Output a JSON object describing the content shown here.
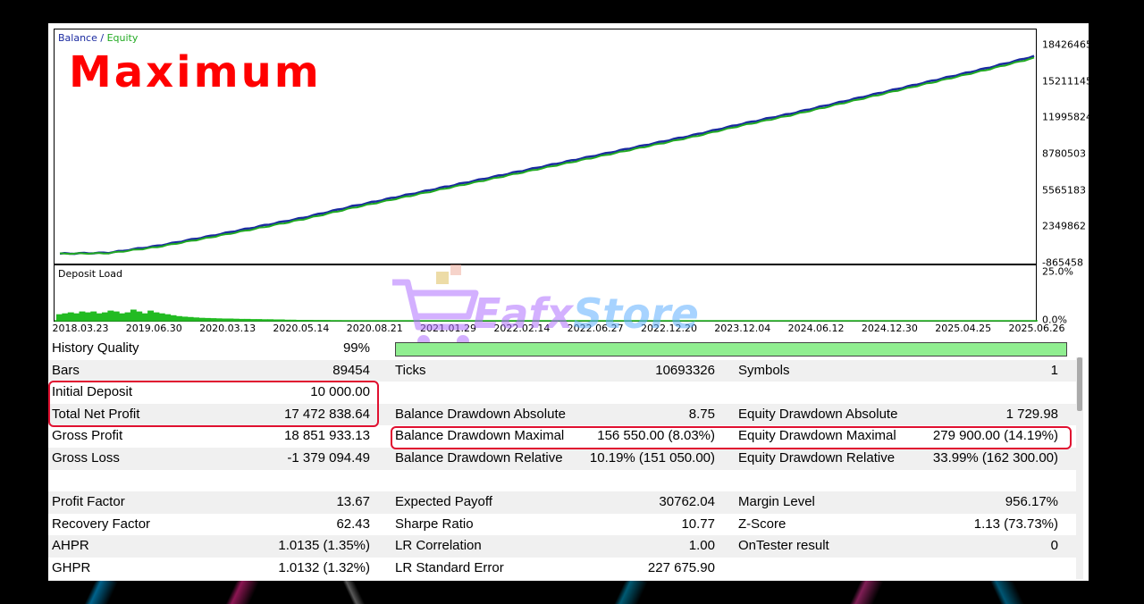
{
  "chart_data": [
    {
      "type": "line",
      "legend": {
        "balance": "Balance",
        "sep": " / ",
        "equity": "Equity"
      },
      "yticks": [
        "18426465",
        "15211145",
        "11995824",
        "8780503",
        "5565183",
        "2349862",
        "-865458"
      ],
      "ytick_values": [
        18426465,
        15211145,
        11995824,
        8780503,
        5565183,
        2349862,
        -865458
      ],
      "ylim": [
        -865458,
        18426465
      ],
      "series": [
        {
          "name": "Balance",
          "color": "#1a2aa0",
          "x": [
            0,
            0.05,
            0.1,
            0.15,
            0.2,
            0.25,
            0.3,
            0.35,
            0.4,
            0.45,
            0.5,
            0.55,
            0.6,
            0.65,
            0.7,
            0.75,
            0.8,
            0.85,
            0.9,
            0.95,
            1.0
          ],
          "values": [
            10000,
            90000,
            700000,
            1500000,
            2350000,
            3200000,
            4200000,
            5100000,
            6000000,
            6900000,
            7800000,
            8700000,
            9600000,
            10500000,
            11500000,
            12400000,
            13400000,
            14400000,
            15400000,
            16400000,
            17482838
          ]
        },
        {
          "name": "Equity",
          "color": "#22aa22",
          "x": [
            0,
            0.05,
            0.1,
            0.15,
            0.2,
            0.25,
            0.3,
            0.35,
            0.4,
            0.45,
            0.5,
            0.55,
            0.6,
            0.65,
            0.7,
            0.75,
            0.8,
            0.85,
            0.9,
            0.95,
            1.0
          ],
          "values": [
            10000,
            50000,
            600000,
            1380000,
            2200000,
            3050000,
            4050000,
            4950000,
            5850000,
            6750000,
            7650000,
            8550000,
            9450000,
            10350000,
            11350000,
            12250000,
            13250000,
            14250000,
            15250000,
            16250000,
            17330000
          ]
        }
      ]
    },
    {
      "type": "bar",
      "title": "Deposit Load",
      "yticks": [
        "25.0%",
        "0.0%"
      ],
      "ylim": [
        0,
        25
      ],
      "values": [
        3.5,
        4,
        4.5,
        4,
        5,
        4.5,
        5,
        4,
        4.5,
        5.5,
        5,
        4,
        4.5,
        6,
        5,
        4,
        5.5,
        4.5,
        4,
        3.5,
        3,
        2.5,
        2.2,
        2,
        1.8,
        1.6,
        1.5,
        1.4,
        1.3,
        1.2,
        1.2,
        1.1,
        1,
        1,
        0.9,
        0.9,
        0.8,
        0.8,
        0.7,
        0.7,
        0.6,
        0.6,
        0.5,
        0.5,
        0.5,
        0.4,
        0.4,
        0.4,
        0.3,
        0.3
      ],
      "xticks": [
        "2018.03.23",
        "2019.06.30",
        "2020.03.13",
        "2020.05.14",
        "2020.08.21",
        "2021.01.29",
        "2022.02.14",
        "2022.06.27",
        "2022.12.20",
        "2023.12.04",
        "2024.06.12",
        "2024.12.30",
        "2025.04.25",
        "2025.06.26"
      ]
    }
  ],
  "overlay_title": "Maximum",
  "watermark": {
    "part1": "Eafx",
    "part2": "Store"
  },
  "stats": {
    "history_quality": {
      "label": "History Quality",
      "value": "99%"
    },
    "rows": [
      {
        "c1l": "Bars",
        "c1v": "89454",
        "c2l": "Ticks",
        "c2v": "10693326",
        "c3l": "Symbols",
        "c3v": "1"
      },
      {
        "c1l": "Initial Deposit",
        "c1v": "10 000.00",
        "c2l": "",
        "c2v": "",
        "c3l": "",
        "c3v": ""
      },
      {
        "c1l": "Total Net Profit",
        "c1v": "17 472 838.64",
        "c2l": "Balance Drawdown Absolute",
        "c2v": "8.75",
        "c3l": "Equity Drawdown Absolute",
        "c3v": "1 729.98"
      },
      {
        "c1l": "Gross Profit",
        "c1v": "18 851 933.13",
        "c2l": "Balance Drawdown Maximal",
        "c2v": "156 550.00 (8.03%)",
        "c3l": "Equity Drawdown Maximal",
        "c3v": "279 900.00 (14.19%)"
      },
      {
        "c1l": "Gross Loss",
        "c1v": "-1 379 094.49",
        "c2l": "Balance Drawdown Relative",
        "c2v": "10.19% (151 050.00)",
        "c3l": "Equity Drawdown Relative",
        "c3v": "33.99% (162 300.00)"
      },
      {
        "c1l": "",
        "c1v": "",
        "c2l": "",
        "c2v": "",
        "c3l": "",
        "c3v": ""
      },
      {
        "c1l": "Profit Factor",
        "c1v": "13.67",
        "c2l": "Expected Payoff",
        "c2v": "30762.04",
        "c3l": "Margin Level",
        "c3v": "956.17%"
      },
      {
        "c1l": "Recovery Factor",
        "c1v": "62.43",
        "c2l": "Sharpe Ratio",
        "c2v": "10.77",
        "c3l": "Z-Score",
        "c3v": "1.13 (73.73%)"
      },
      {
        "c1l": "AHPR",
        "c1v": "1.0135 (1.35%)",
        "c2l": "LR Correlation",
        "c2v": "1.00",
        "c3l": "OnTester result",
        "c3v": "0"
      },
      {
        "c1l": "GHPR",
        "c1v": "1.0132 (1.32%)",
        "c2l": "LR Standard Error",
        "c2v": "227 675.90",
        "c3l": "",
        "c3v": ""
      }
    ]
  },
  "colors": {
    "balance": "#1a2aa0",
    "equity": "#22aa22",
    "deposit_load": "#22bb22",
    "highlight": "#e01030",
    "title": "#ff0000"
  }
}
